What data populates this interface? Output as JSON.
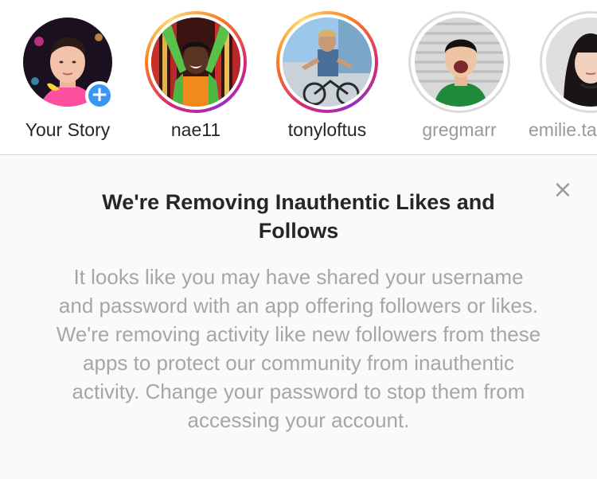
{
  "stories": [
    {
      "username": "Your Story",
      "state": "own",
      "add_icon": "+"
    },
    {
      "username": "nae11",
      "state": "unseen"
    },
    {
      "username": "tonyloftus",
      "state": "unseen"
    },
    {
      "username": "gregmarr",
      "state": "seen"
    },
    {
      "username": "emilie.ta",
      "state": "seen"
    }
  ],
  "notice": {
    "title": "We're Removing Inauthentic Likes and Follows",
    "body": "It looks like you may have shared your username and password with an app offering followers or likes. We're removing activity like new followers from these apps to protect our community from inauthentic activity. Change your password to stop them from accessing your account.",
    "close_icon": "×"
  },
  "colors": {
    "add_badge": "#3897f0",
    "ring_gradient": [
      "#d62976",
      "#fa7e1e",
      "#feda75",
      "#962fbf"
    ],
    "ring_seen": "#dbdbdb",
    "notice_background": "#fafafa",
    "body_text": "#a6a6a6"
  }
}
